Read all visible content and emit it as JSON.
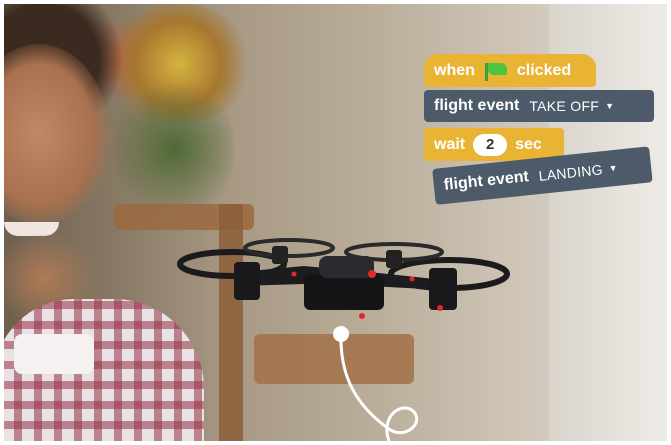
{
  "scene": {
    "description_colors": {
      "yellow_block": "#e9b434",
      "slate_block": "#4d5a69",
      "flag_green": "#4cc43f",
      "drone_led": "#e0282c"
    }
  },
  "blocks": {
    "when_label": "when",
    "flag_icon": "green-flag-icon",
    "clicked_label": "clicked",
    "flight_event_1": {
      "label": "flight event",
      "value": "TAKE OFF",
      "caret": "▼"
    },
    "wait": {
      "label": "wait",
      "value": "2",
      "unit": "sec"
    },
    "flight_event_2": {
      "label": "flight event",
      "value": "LANDING",
      "caret": "▼"
    }
  }
}
